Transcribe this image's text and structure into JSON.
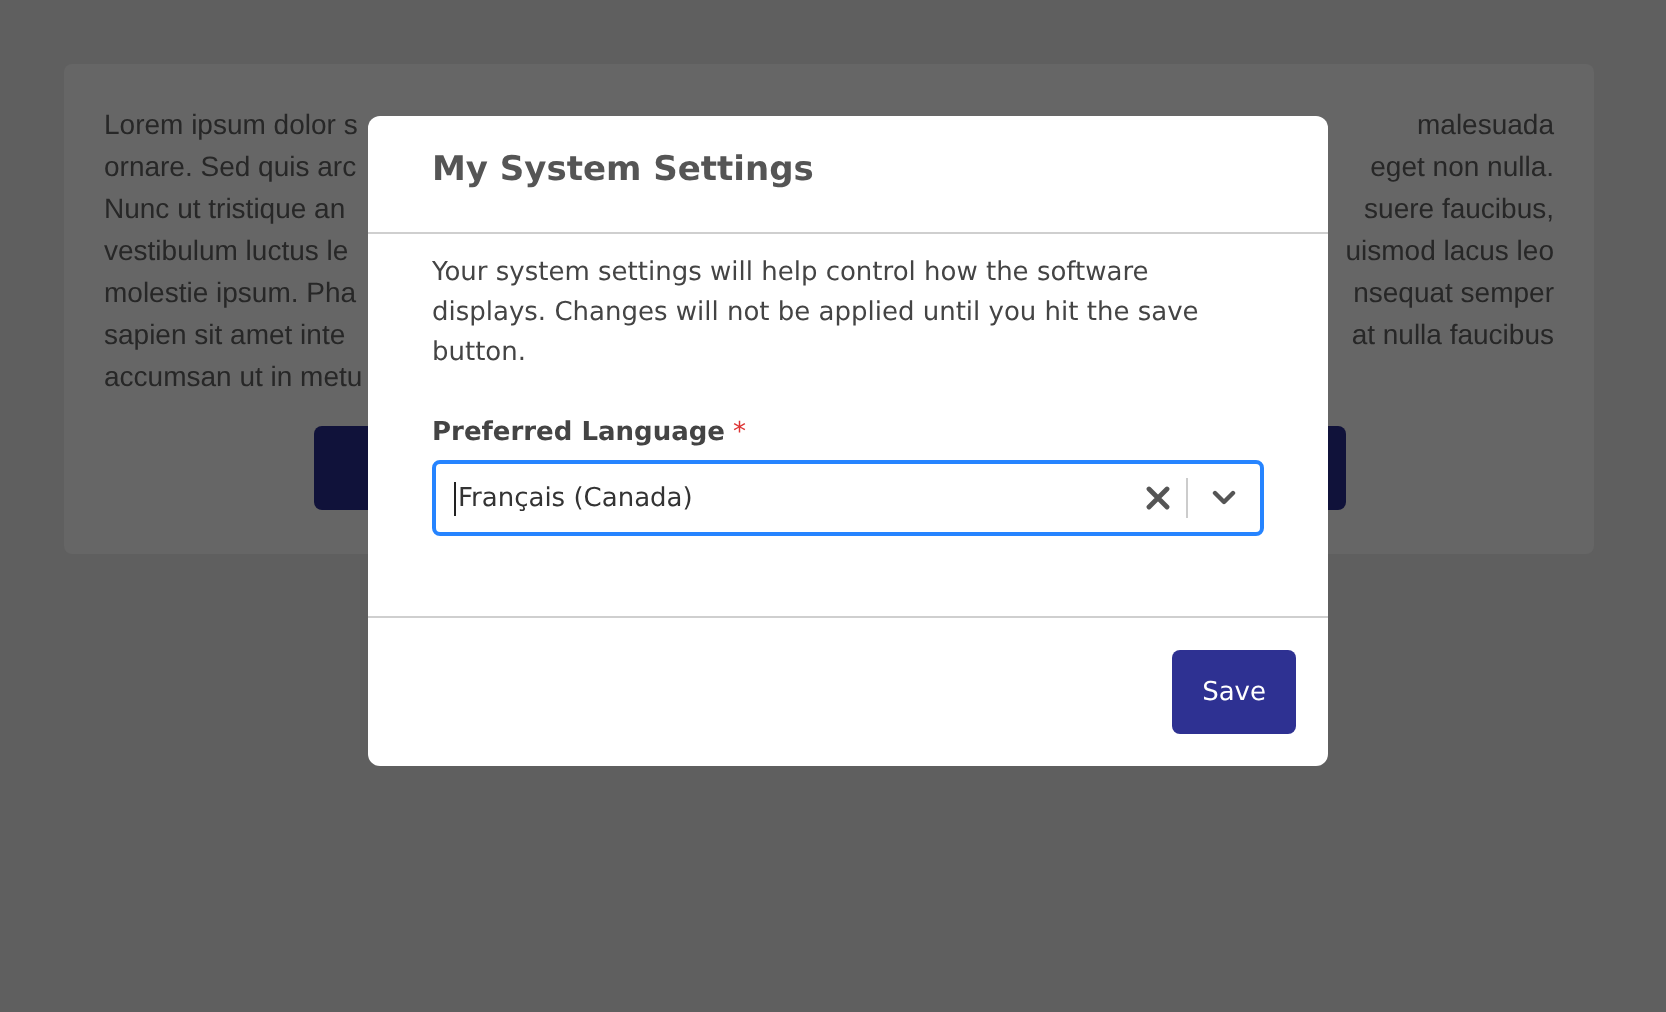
{
  "background_card": {
    "lines": [
      {
        "left": "Lorem ipsum dolor s",
        "right": "malesuada"
      },
      {
        "left": "ornare. Sed quis arc",
        "right": "eget non nulla."
      },
      {
        "left": "Nunc ut tristique an",
        "right": "suere faucibus,"
      },
      {
        "left": "vestibulum luctus le",
        "right": "uismod lacus leo"
      },
      {
        "left": "molestie ipsum. Pha",
        "right": "nsequat semper"
      },
      {
        "left": "sapien sit amet inte",
        "right": "at nulla faucibus"
      },
      {
        "left": "accumsan ut in metu"
      }
    ]
  },
  "dialog": {
    "title": "My System Settings",
    "description": "Your system settings will help control how the software displays. Changes will not be applied until you hit the save button.",
    "field": {
      "label": "Preferred Language",
      "required": true,
      "required_mark": "*",
      "value": "Français (Canada)",
      "focused": true
    },
    "buttons": [
      "Save"
    ]
  }
}
